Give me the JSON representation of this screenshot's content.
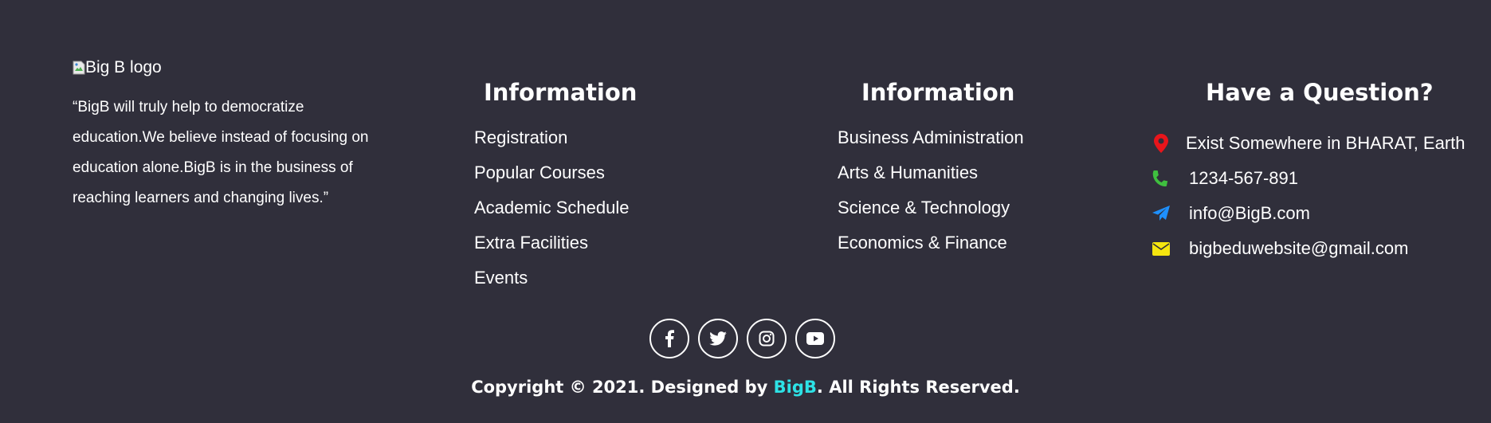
{
  "about": {
    "logo_alt": "Big B logo",
    "text": "“BigB will truly help to democratize education.We believe instead of focusing on education alone.BigB is in the business of reaching learners and changing lives.”"
  },
  "columns": [
    {
      "title": "Information",
      "links": [
        "Registration",
        "Popular Courses",
        "Academic Schedule",
        "Extra Facilities",
        "Events"
      ]
    },
    {
      "title": "Information",
      "links": [
        "Business Administration",
        "Arts & Humanities",
        "Science & Technology",
        "Economics & Finance"
      ]
    }
  ],
  "contact": {
    "title": "Have a Question?",
    "items": [
      {
        "icon": "map-pin-icon",
        "text": "Exist Somewhere in BHARAT, Earth"
      },
      {
        "icon": "phone-icon",
        "text": "1234-567-891"
      },
      {
        "icon": "paper-plane-icon",
        "text": "info@BigB.com"
      },
      {
        "icon": "envelope-icon",
        "text": "bigbeduwebsite@gmail.com"
      }
    ]
  },
  "social": [
    {
      "icon": "facebook-icon",
      "label": "Facebook"
    },
    {
      "icon": "twitter-icon",
      "label": "Twitter"
    },
    {
      "icon": "instagram-icon",
      "label": "Instagram"
    },
    {
      "icon": "youtube-icon",
      "label": "YouTube"
    }
  ],
  "copyright": {
    "prefix": "Copyright © 2021. Designed by ",
    "brand": "BigB",
    "suffix": ". All Rights Reserved."
  },
  "colors": {
    "background": "#302f3b",
    "text": "#ffffff",
    "brand_accent": "#2de2e6",
    "pin": "#e8151b",
    "phone": "#3fbf3f",
    "plane": "#1e90ff",
    "envelope": "#f5e50f"
  }
}
